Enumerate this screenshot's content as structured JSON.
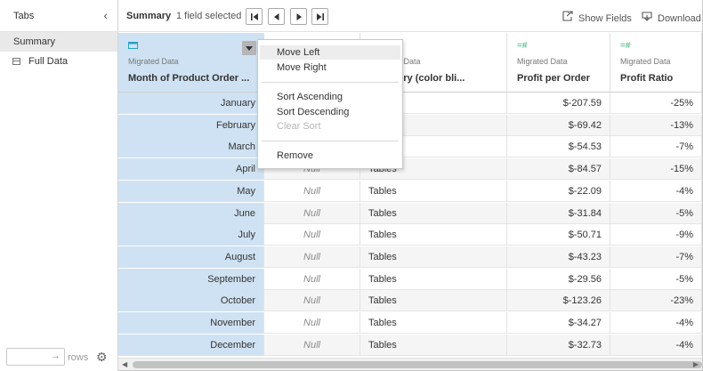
{
  "sidebar": {
    "title": "Tabs",
    "collapse_icon": "‹",
    "items": [
      {
        "label": "Summary",
        "active": true
      },
      {
        "label": "Full Data",
        "active": false
      }
    ],
    "rows_placeholder": "",
    "rows_arrow": "→",
    "rows_label": "rows",
    "gear_icon": "⚙"
  },
  "toolbar": {
    "title": "Summary",
    "selection": "1 field selected",
    "show_fields": "Show Fields",
    "download": "Download"
  },
  "columns": [
    {
      "type_icon": "date",
      "source": "Migrated Data",
      "name": "Month of Product Order ...",
      "selected": true
    },
    {
      "type_icon": "",
      "source": "",
      "name": "",
      "selected": false
    },
    {
      "type_icon": "",
      "source": "Migrated Data",
      "name": "Category (color bli...",
      "selected": false
    },
    {
      "type_icon": "number",
      "source": "Migrated Data",
      "name": "Profit per Order",
      "selected": false
    },
    {
      "type_icon": "number",
      "source": "Migrated Data",
      "name": "Profit Ratio",
      "selected": false
    }
  ],
  "rows": [
    {
      "month": "January",
      "col2": "",
      "category": "",
      "profit": "$-207.59",
      "ratio": "-25%"
    },
    {
      "month": "February",
      "col2": "",
      "category": "",
      "profit": "$-69.42",
      "ratio": "-13%"
    },
    {
      "month": "March",
      "col2": "",
      "category": "",
      "profit": "$-54.53",
      "ratio": "-7%"
    },
    {
      "month": "April",
      "col2": "Null",
      "category": "Tables",
      "profit": "$-84.57",
      "ratio": "-15%"
    },
    {
      "month": "May",
      "col2": "Null",
      "category": "Tables",
      "profit": "$-22.09",
      "ratio": "-4%"
    },
    {
      "month": "June",
      "col2": "Null",
      "category": "Tables",
      "profit": "$-31.84",
      "ratio": "-5%"
    },
    {
      "month": "July",
      "col2": "Null",
      "category": "Tables",
      "profit": "$-50.71",
      "ratio": "-9%"
    },
    {
      "month": "August",
      "col2": "Null",
      "category": "Tables",
      "profit": "$-43.23",
      "ratio": "-7%"
    },
    {
      "month": "September",
      "col2": "Null",
      "category": "Tables",
      "profit": "$-29.56",
      "ratio": "-5%"
    },
    {
      "month": "October",
      "col2": "Null",
      "category": "Tables",
      "profit": "$-123.26",
      "ratio": "-23%"
    },
    {
      "month": "November",
      "col2": "Null",
      "category": "Tables",
      "profit": "$-34.27",
      "ratio": "-4%"
    },
    {
      "month": "December",
      "col2": "Null",
      "category": "Tables",
      "profit": "$-32.73",
      "ratio": "-4%"
    }
  ],
  "menu": {
    "move_left": "Move Left",
    "move_right": "Move Right",
    "sort_ascending": "Sort Ascending",
    "sort_descending": "Sort Descending",
    "clear_sort": "Clear Sort",
    "remove": "Remove"
  },
  "colors": {
    "selection": "#cfe2f3",
    "date_icon": "#23a3c4",
    "number_icon": "#2bb67b"
  }
}
